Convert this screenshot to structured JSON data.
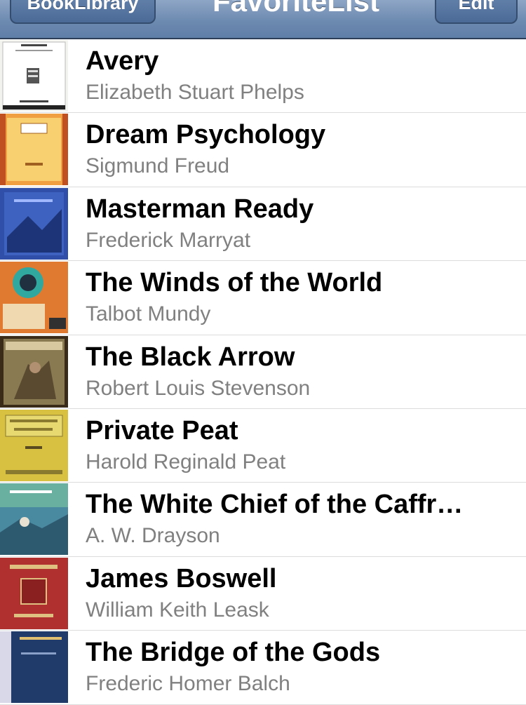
{
  "navbar": {
    "back_label": "BookLibrary",
    "title": "FavoriteList",
    "edit_label": "Edit"
  },
  "books": [
    {
      "title": "Avery",
      "author": "Elizabeth Stuart Phelps",
      "cover_color": "#f2f2ee"
    },
    {
      "title": "Dream Psychology",
      "author": "Sigmund Freud",
      "cover_color": "#f0a040"
    },
    {
      "title": "Masterman Ready",
      "author": "Frederick Marryat",
      "cover_color": "#2f4fa8"
    },
    {
      "title": "The Winds of the World",
      "author": "Talbot Mundy",
      "cover_color": "#e07a30"
    },
    {
      "title": "The Black Arrow",
      "author": "Robert Louis Stevenson",
      "cover_color": "#8a7a52"
    },
    {
      "title": "Private Peat",
      "author": "Harold Reginald Peat",
      "cover_color": "#d8c040"
    },
    {
      "title": "The White Chief of the Caffr…",
      "author": "A. W. Drayson",
      "cover_color": "#4a8aa0"
    },
    {
      "title": "James Boswell",
      "author": "William Keith Leask",
      "cover_color": "#b03030"
    },
    {
      "title": "The Bridge of the Gods",
      "author": "Frederic Homer Balch",
      "cover_color": "#203a6a"
    }
  ]
}
